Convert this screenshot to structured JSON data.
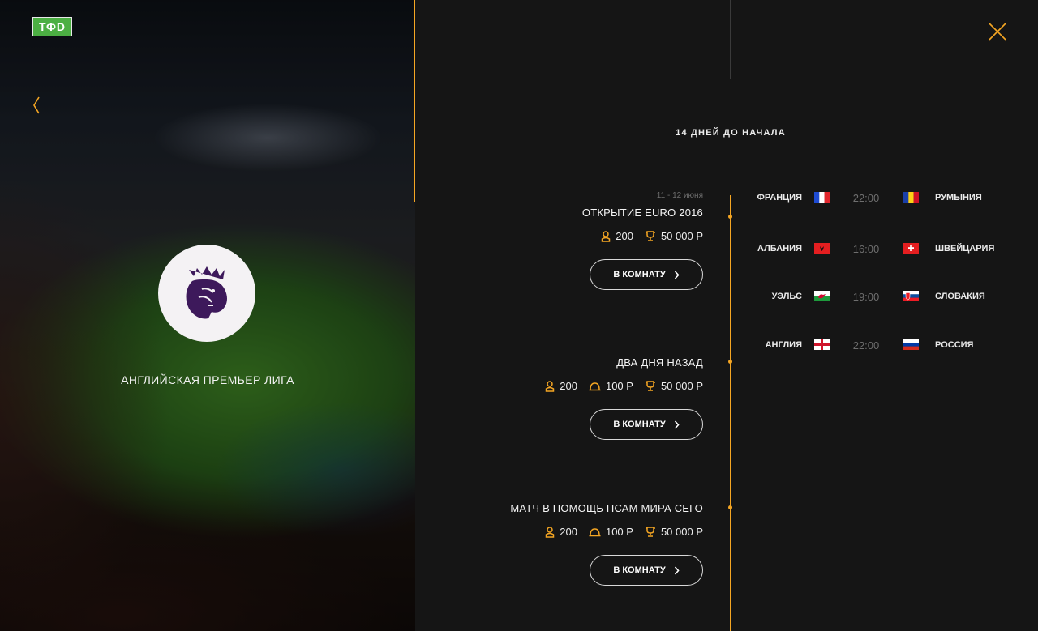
{
  "brand": {
    "logo_text": "ТФD"
  },
  "league": {
    "name": "АНГЛИЙСКАЯ ПРЕМЬЕР ЛИГА"
  },
  "countdown": "14 ДНЕЙ ДО НАЧАЛА",
  "colors": {
    "accent": "#f5a623",
    "background": "#151515",
    "league_purple": "#3d195b"
  },
  "icons": {
    "back": "chevron-left-icon",
    "close": "close-x-icon",
    "players": "person-icon",
    "entry_fee": "coin-icon",
    "prize": "trophy-icon",
    "button_arrow": "chevron-right-icon"
  },
  "events": [
    {
      "date": "11 - 12 июня",
      "title": "ОТКРЫТИЕ EURO 2016",
      "players": "200",
      "prize": "50 000 Р",
      "button": "В КОМНАТУ"
    },
    {
      "title": "ДВА ДНЯ НАЗАД",
      "players": "200",
      "fee": "100 Р",
      "prize": "50 000 Р",
      "button": "В КОМНАТУ"
    },
    {
      "title": "МАТЧ В ПОМОЩЬ ПСАМ МИРА СЕГО",
      "players": "200",
      "fee": "100 Р",
      "prize": "50 000 Р",
      "button": "В КОМНАТУ"
    }
  ],
  "matches": [
    {
      "home": "ФРАНЦИЯ",
      "time": "22:00",
      "away": "РУМЫНИЯ"
    },
    {
      "home": "АЛБАНИЯ",
      "time": "16:00",
      "away": "ШВЕЙЦАРИЯ"
    },
    {
      "home": "УЭЛЬС",
      "time": "19:00",
      "away": "СЛОВАКИЯ"
    },
    {
      "home": "АНГЛИЯ",
      "time": "22:00",
      "away": "РОССИЯ"
    }
  ]
}
